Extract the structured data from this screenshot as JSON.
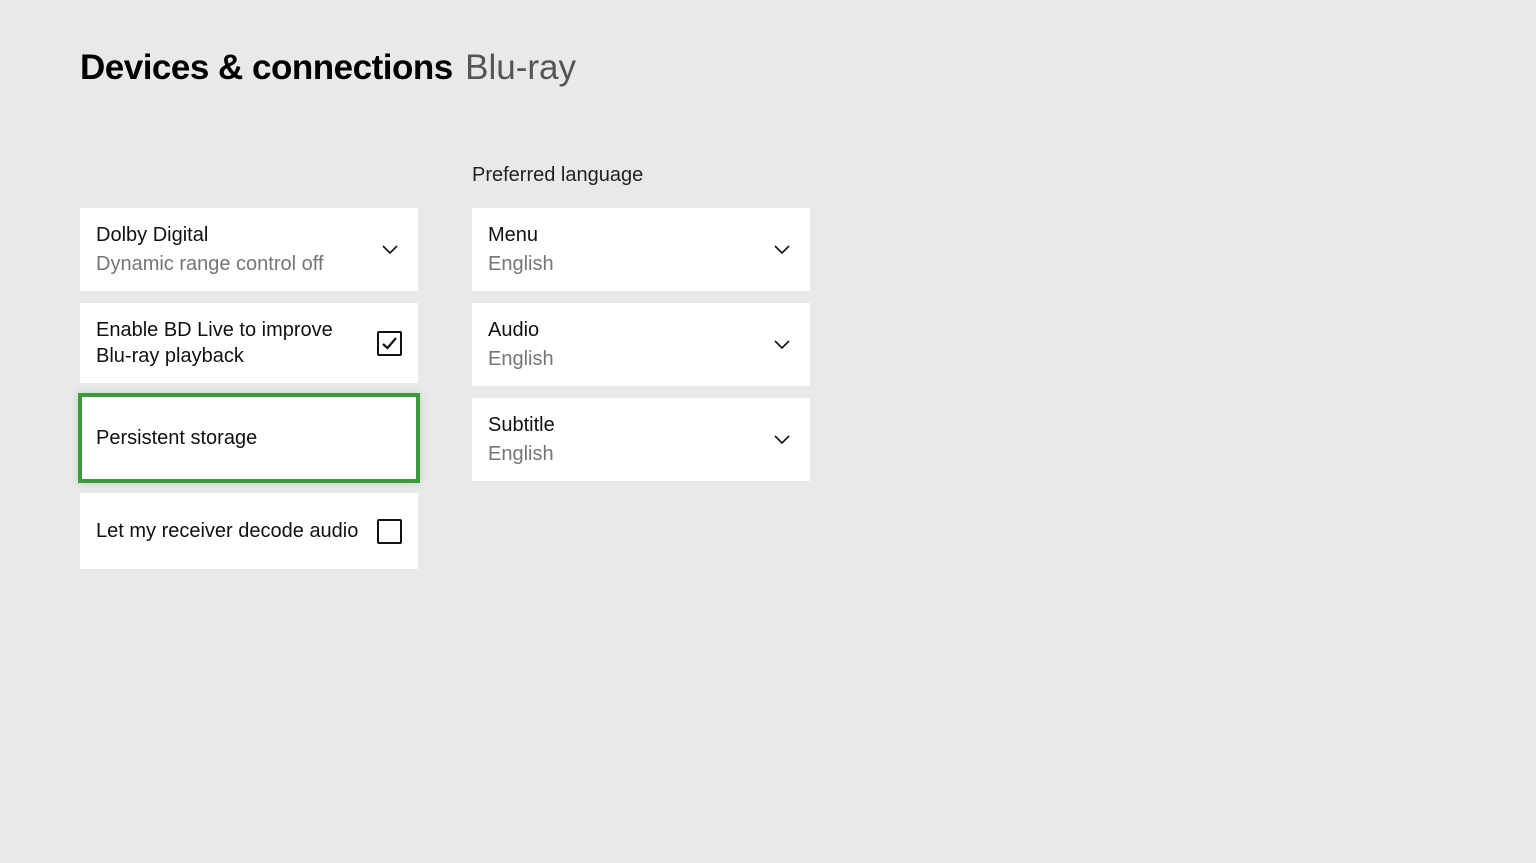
{
  "header": {
    "title": "Devices & connections",
    "sub": "Blu-ray"
  },
  "leftColumn": {
    "dolby": {
      "label": "Dolby Digital",
      "value": "Dynamic range control off"
    },
    "bdlive": {
      "label": "Enable BD Live to improve Blu-ray playback",
      "checked": true
    },
    "persistent": {
      "label": "Persistent storage"
    },
    "receiver": {
      "label": "Let my receiver decode audio",
      "checked": false
    }
  },
  "rightColumn": {
    "header": "Preferred language",
    "menu": {
      "label": "Menu",
      "value": "English"
    },
    "audio": {
      "label": "Audio",
      "value": "English"
    },
    "subtitle": {
      "label": "Subtitle",
      "value": "English"
    }
  }
}
